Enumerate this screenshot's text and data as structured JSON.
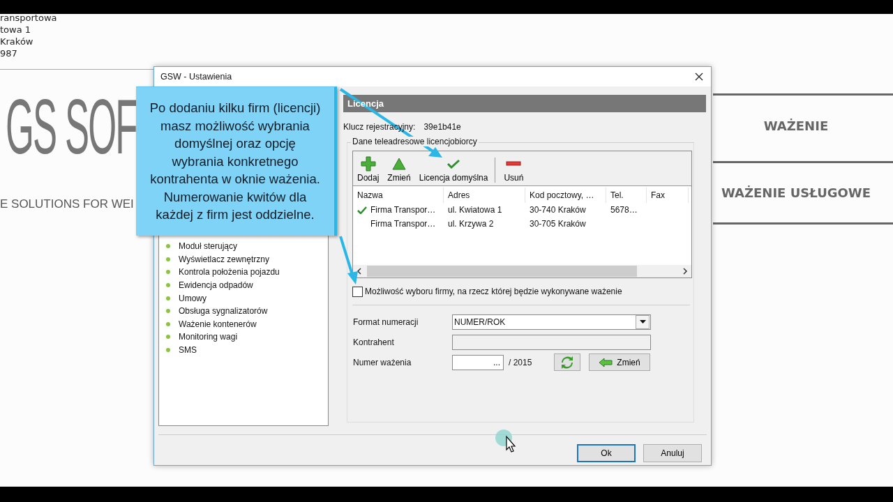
{
  "background": {
    "address_lines": [
      "ransportowa",
      "towa 1",
      " Kraków",
      "987"
    ],
    "logo": "GS SOF",
    "tagline": "E SOLUTIONS FOR WEI",
    "menu": [
      "WAŻENIE",
      "WAŻENIE USŁUGOWE"
    ]
  },
  "dialog": {
    "title": "GSW - Ustawienia",
    "nav_items": [
      "Moduł sterujący",
      "Wyświetlacz zewnętrzny",
      "Kontrola położenia pojazdu",
      "Ewidencja odpadów",
      "Umowy",
      "Obsługa sygnalizatorów",
      "Ważenie kontenerów",
      "Monitoring wagi",
      "SMS"
    ],
    "section_title": "Licencja",
    "key_label": "Klucz rejestracyjny:",
    "key_value": "39e1b41e",
    "group_title": "Dane teleadresowe licencjobiorcy",
    "toolbar": [
      {
        "kind": "add",
        "label": "Dodaj"
      },
      {
        "kind": "edit",
        "label": "Zmień"
      },
      {
        "kind": "default",
        "label": "Licencja domyślna"
      },
      {
        "kind": "remove",
        "label": "Usuń"
      }
    ],
    "columns": [
      "Nazwa",
      "Adres",
      "Kod pocztowy, …",
      "Tel.",
      "Fax"
    ],
    "rows": [
      {
        "default": true,
        "cells": [
          "Firma Transpor…",
          "ul. Kwiatowa 1",
          "30-740 Kraków",
          "5678…",
          ""
        ]
      },
      {
        "default": false,
        "cells": [
          "Firma Transpor…",
          "ul. Krzywa 2",
          "30-705 Kraków",
          "",
          ""
        ]
      }
    ],
    "company_choice": {
      "label": "Możliwość wyboru firmy, na rzecz której będzie wykonywane ważenie",
      "checked": false
    },
    "fields": [
      {
        "kind": "select",
        "label": "Format numeracji",
        "value": "NUMER/ROK"
      },
      {
        "kind": "text",
        "label": "Kontrahent",
        "disabled": true
      },
      {
        "kind": "number",
        "label": "Numer ważenia",
        "value": "...",
        "suffix": "/ 2015",
        "action": "Zmień"
      }
    ],
    "buttons": [
      {
        "label": "Ok",
        "selected": true
      },
      {
        "label": "Anuluj",
        "selected": false
      }
    ]
  },
  "callout": {
    "text": "Po dodaniu kilku firm (licencji)\nmasz możliwość wybrania\ndomyślnej oraz opcję\nwybrania konkretnego\nkontrahenta w oknie ważenia.\nNumerowanie kwitów dla\nkażdej z firm jest oddzielne."
  }
}
